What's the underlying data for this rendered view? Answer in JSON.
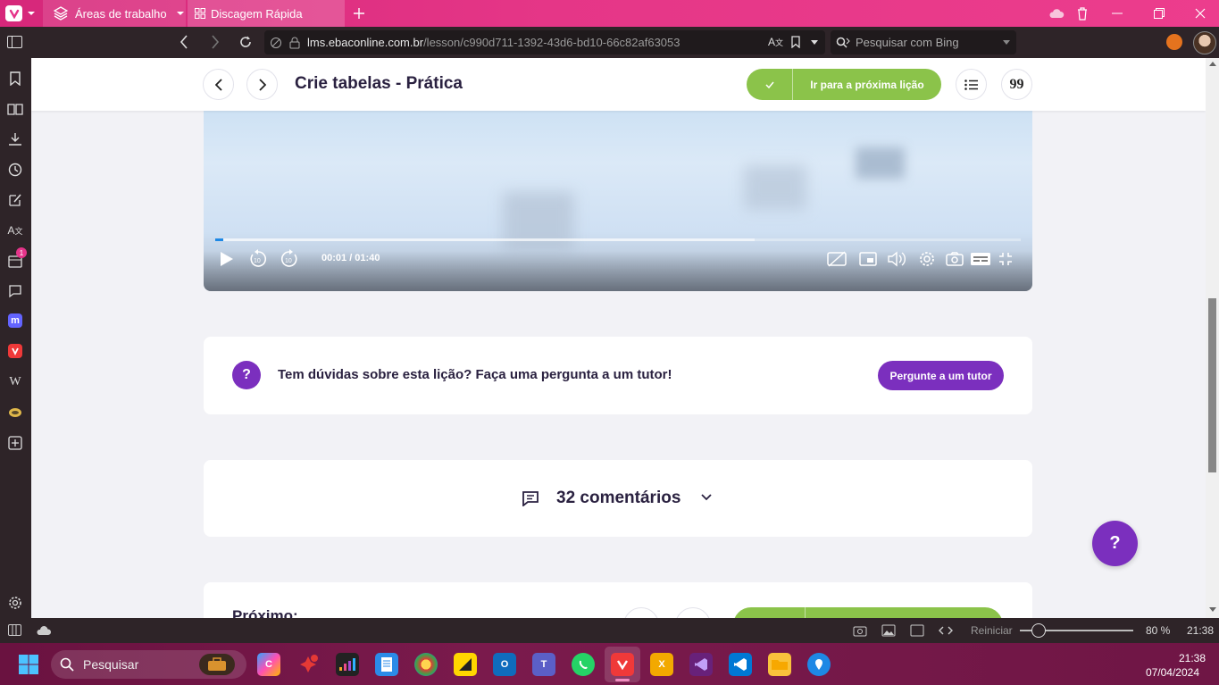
{
  "browser": {
    "tabs": [
      {
        "label": "Áreas de trabalho"
      },
      {
        "label": "Discagem Rápida"
      }
    ],
    "url": {
      "host": "lms.ebaconline.com.br",
      "path": "/lesson/c990d711-1392-43d6-bd10-66c82af63053"
    },
    "search_placeholder": "Pesquisar com Bing",
    "accent": "#e5348a"
  },
  "lesson": {
    "title": "Crie tabelas - Prática",
    "next_button": "Ir para a próxima lição",
    "accent_green": "#8bc34a"
  },
  "video": {
    "time": "00:01 / 01:40",
    "progress": 0.01,
    "buffered": 0.67
  },
  "tutor": {
    "question": "Tem dúvidas sobre esta lição? Faça uma pergunta a um tutor!",
    "button": "Pergunte a um tutor",
    "accent_purple": "#7b2fbe"
  },
  "comments": {
    "label": "32 comentários"
  },
  "next_section": {
    "label": "Próximo:"
  },
  "fab": {
    "label": "?"
  },
  "tutor_icon": {
    "label": "?"
  },
  "statusbar": {
    "reset": "Reiniciar",
    "zoom": "80 %",
    "time": "21:38"
  },
  "taskbar": {
    "search_placeholder": "Pesquisar",
    "clock_time": "21:38",
    "clock_date": "07/04/2024"
  },
  "sidebar": {
    "notification_badge": "1"
  }
}
